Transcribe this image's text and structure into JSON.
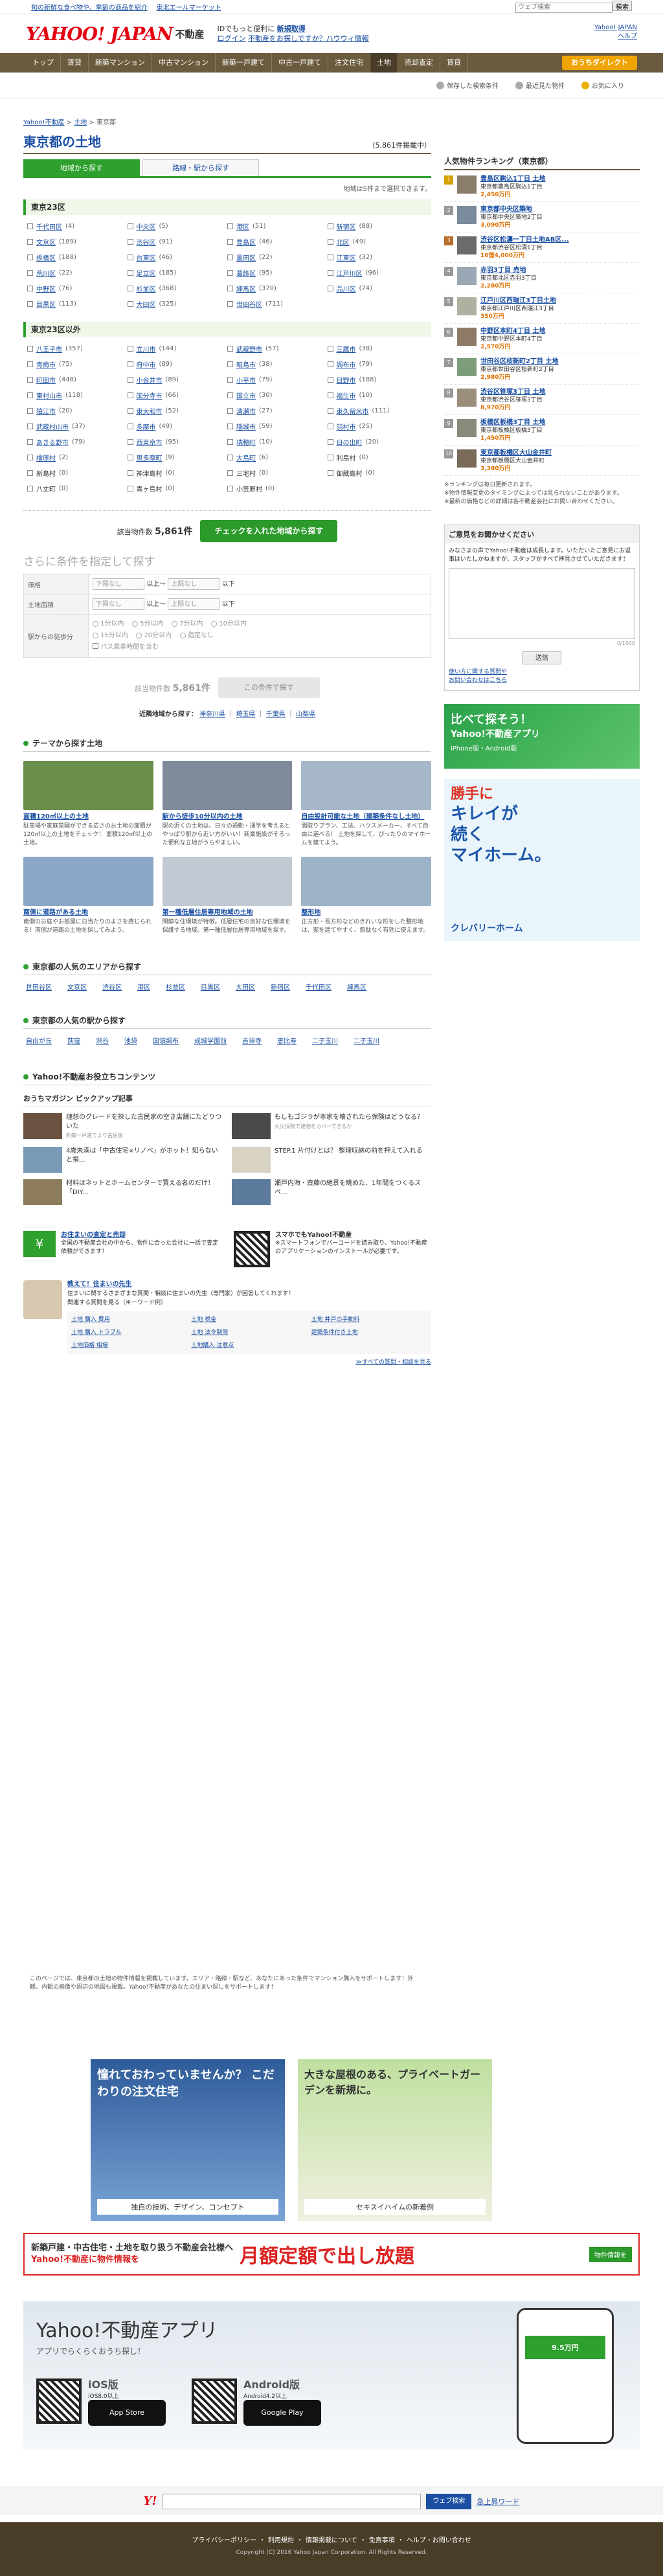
{
  "topbar": {
    "links": [
      "旬の新鮮な食べ物や、季節の商品を紹介",
      "東北エールマーケット"
    ],
    "search_placeholder": "ウェブ検索",
    "search_btn": "検索"
  },
  "header": {
    "logo_y": "YAHOO! JAPAN",
    "logo_fd": "不動産",
    "sub1": "IDでもっと便利に",
    "sub1b": "新規取得",
    "sub2": "ログイン",
    "sub3": "不動産をお探しですか？ハウウィ情報",
    "right1": "Yahoo! JAPAN",
    "right2": "ヘルプ"
  },
  "gnav": {
    "items": [
      "トップ",
      "賃貸",
      "新築マンション",
      "中古マンション",
      "新築一戸建て",
      "中古一戸建て",
      "注文住宅",
      "土地",
      "売却査定",
      "賃貸"
    ],
    "active": 7,
    "direct": "おうちダイレクト"
  },
  "subnav": {
    "items": [
      "保存した検索条件",
      "最近見た物件",
      "お気に入り"
    ]
  },
  "crumb": [
    "Yahoo!不動産",
    "土地",
    "東京都"
  ],
  "page": {
    "title": "東京都の土地",
    "count": "（5,861件掲載中）",
    "tab1": "地域から探す",
    "tab2": "路線・駅から探す",
    "note": "地域は5件まで選択できます。"
  },
  "sec1": {
    "title": "東京23区",
    "items": [
      [
        "千代田区",
        "(4)"
      ],
      [
        "中央区",
        "(5)"
      ],
      [
        "港区",
        "(51)"
      ],
      [
        "新宿区",
        "(88)"
      ],
      [
        "文京区",
        "(189)"
      ],
      [
        "渋谷区",
        "(91)"
      ],
      [
        "豊島区",
        "(46)"
      ],
      [
        "北区",
        "(49)"
      ],
      [
        "板橋区",
        "(188)"
      ],
      [
        "台東区",
        "(46)"
      ],
      [
        "墨田区",
        "(22)"
      ],
      [
        "江東区",
        "(32)"
      ],
      [
        "荒川区",
        "(22)"
      ],
      [
        "足立区",
        "(185)"
      ],
      [
        "葛飾区",
        "(95)"
      ],
      [
        "江戸川区",
        "(96)"
      ],
      [
        "中野区",
        "(76)"
      ],
      [
        "杉並区",
        "(368)"
      ],
      [
        "練馬区",
        "(370)"
      ],
      [
        "品川区",
        "(74)"
      ],
      [
        "目黒区",
        "(113)"
      ],
      [
        "大田区",
        "(325)"
      ],
      [
        "世田谷区",
        "(711)"
      ],
      [
        "",
        ""
      ]
    ]
  },
  "sec2": {
    "title": "東京23区以外",
    "items": [
      [
        "八王子市",
        "(357)"
      ],
      [
        "立川市",
        "(144)"
      ],
      [
        "武蔵野市",
        "(57)"
      ],
      [
        "三鷹市",
        "(38)"
      ],
      [
        "青梅市",
        "(75)"
      ],
      [
        "府中市",
        "(89)"
      ],
      [
        "昭島市",
        "(38)"
      ],
      [
        "調布市",
        "(79)"
      ],
      [
        "町田市",
        "(448)"
      ],
      [
        "小金井市",
        "(89)"
      ],
      [
        "小平市",
        "(79)"
      ],
      [
        "日野市",
        "(188)"
      ],
      [
        "東村山市",
        "(118)"
      ],
      [
        "国分寺市",
        "(66)"
      ],
      [
        "国立市",
        "(30)"
      ],
      [
        "福生市",
        "(10)"
      ],
      [
        "狛江市",
        "(20)"
      ],
      [
        "東大和市",
        "(52)"
      ],
      [
        "清瀬市",
        "(27)"
      ],
      [
        "東久留米市",
        "(111)"
      ],
      [
        "武蔵村山市",
        "(37)"
      ],
      [
        "多摩市",
        "(49)"
      ],
      [
        "稲城市",
        "(59)"
      ],
      [
        "羽村市",
        "(25)"
      ],
      [
        "あきる野市",
        "(79)"
      ],
      [
        "西東京市",
        "(95)"
      ],
      [
        "瑞穂町",
        "(10)"
      ],
      [
        "日の出町",
        "(20)"
      ],
      [
        "檜原村",
        "(2)"
      ],
      [
        "奥多摩町",
        "(9)"
      ],
      [
        "大島町",
        "(6)"
      ],
      [
        "利島村",
        "(0)"
      ],
      [
        "新島村",
        "(0)"
      ],
      [
        "神津島村",
        "(0)"
      ],
      [
        "三宅村",
        "(0)"
      ],
      [
        "御蔵島村",
        "(0)"
      ],
      [
        "八丈町",
        "(0)"
      ],
      [
        "青ヶ島村",
        "(0)"
      ],
      [
        "小笠原村",
        "(0)"
      ],
      [
        "",
        ""
      ]
    ]
  },
  "select": {
    "label": "該当物件数",
    "count": "5,861件",
    "btn": "チェックを入れた地域から探す"
  },
  "cond": {
    "title": "さらに条件を指定して探す",
    "r1": "価格",
    "r2": "土地面積",
    "r3": "駅からの徒歩分",
    "any": "下限なし",
    "up": "上限なし",
    "to": "以上〜",
    "pt": "以下",
    "walk": [
      "1分以内",
      "5分以内",
      "7分以内",
      "10分以内",
      "15分以内",
      "20分以内",
      "指定なし"
    ],
    "bus": "バス乗車時間を含む",
    "count_label": "該当物件数",
    "count": "5,861件",
    "btn": "この条件で探す"
  },
  "nearby": {
    "label": "近隣地域から探す：",
    "items": [
      "神奈川県",
      "埼玉県",
      "千葉県",
      "山梨県"
    ]
  },
  "themes": {
    "title": "テーマから探す土地",
    "items": [
      {
        "t": "面積120㎡以上の土地",
        "d": "駐車場や家庭菜園ができる広さのお土地の面積が120㎡以上の土地をチェック！ 面積120㎡以上の土地。",
        "c": "#6a8f4a"
      },
      {
        "t": "駅から徒歩10分以内の土地",
        "d": "駅の近くの土地は、日々の通勤・通学を考えるとやっぱり駅から近い方がいい！商業施設がそろった便利な立地がうらやましい。",
        "c": "#7f8a9a"
      },
      {
        "t": "自由設計可能な土地（建築条件なし土地）",
        "d": "間取りプラン、工法、ハウスメーカー、すべて自由に選べる！ 土地を探して、ぴったりのマイホームを建てよう。",
        "c": "#a6b7c9"
      },
      {
        "t": "南側に道路がある土地",
        "d": "南側のお庭やお部屋に日当たりのよさを感じられる！南側が道路の土地を探してみよう。",
        "c": "#8aa7c7"
      },
      {
        "t": "第一種低層住居専用地域の土地",
        "d": "閑静な住環境が特徴。低層住宅の良好な住環境を保護する地域。第一種低層住居専用地域を探す。",
        "c": "#c1c9d2"
      },
      {
        "t": "整形地",
        "d": "正方形・長方形などのきれいな形をした整形地は、家を建てやすく、無駄なく有効に使えます。",
        "c": "#9cb3c8"
      }
    ]
  },
  "areas": {
    "title": "東京都の人気のエリアから探す",
    "items": [
      "世田谷区",
      "文京区",
      "渋谷区",
      "港区",
      "杉並区",
      "目黒区",
      "大田区",
      "新宿区",
      "千代田区",
      "練馬区"
    ]
  },
  "stations": {
    "title": "東京都の人気の駅から探す",
    "items": [
      "自由が丘",
      "荻窪",
      "渋谷",
      "池袋",
      "国領調布",
      "成城学園前",
      "吉祥寺",
      "恵比寿",
      "二子玉川",
      "二子玉川"
    ]
  },
  "useful": {
    "title": "Yahoo!不動産お役立ちコンテンツ",
    "mag_title": "おうちマガジン  ピックアップ記事",
    "articles": [
      {
        "t": "理想のグレードを探した古民家の空き店舗にたどりついた",
        "s": "新築一戸建てより古民家",
        "c": "#6b5140"
      },
      {
        "t": "もしもゴジラが本家を壊されたら保険はどうなる？",
        "s": "火災保険で建物をカバーできるか",
        "c": "#4a4a4a"
      },
      {
        "t": "4歳未満は「中古住宅×リノベ」がホット！知らないと損...",
        "s": "",
        "c": "#7b9ab8"
      },
      {
        "t": "STEP.1 片付けとは？ 整理収納の前を押えて入れる",
        "s": "",
        "c": "#d9d3c4"
      },
      {
        "t": "材料はネットとホームセンターで買える名のだけ！「DIY...",
        "s": "",
        "c": "#8c7c5c"
      },
      {
        "t": "瀬戸内海・齋藤の絶景を眺めた、1年間をつくるスペ...",
        "s": "",
        "c": "#5c7a9c"
      }
    ],
    "box1_t": "お住まいの査定と売却",
    "box1_d": "全国の不動産会社の中から、物件に合った会社に一括で査定依頼ができます！",
    "box2_t": "スマホでもYahoo!不動産",
    "box2_d": "※スマートフォンでバーコードを読み取り、Yahoo!不動産のアプリケーションのインストールが必要です。",
    "box3_t": "教えて！住まいの先生",
    "box3_d": "住まいに関するさまざまな質問・相談に住まいの先生（専門家）が回答してくれます！",
    "box3_s": "関連する質問を見る（キーワード例）",
    "kw": [
      "土地 購入 費用",
      "土地 税金",
      "土地 井戸の手動料",
      "土地 購入 トラブル",
      "土地 法令制限",
      "建築条件付き土地",
      "土地価格 相場",
      "土地購入 注意点"
    ],
    "all": "≫すべての質問・相談を見る"
  },
  "ranking": {
    "title": "人気物件ランキング（東京都）",
    "items": [
      {
        "t": "豊島区駒込1丁目 土地",
        "a": "東京都豊島区駒込1丁目",
        "p": "2,450万円",
        "c": "#8b7d6b"
      },
      {
        "t": "東京都中央区築地",
        "a": "東京都中央区築地2丁目",
        "p": "3,090万円",
        "c": "#7a8c9b"
      },
      {
        "t": "渋谷区松濤一丁目土地AB区...",
        "a": "東京都渋谷区松濤1丁目",
        "p": "16億4,000万円",
        "c": "#6b6b6b"
      },
      {
        "t": "赤羽3丁目 売地",
        "a": "東京都北区赤羽3丁目",
        "p": "2,280万円",
        "c": "#9aa8b5"
      },
      {
        "t": "江戸川区西瑞江3丁目土地",
        "a": "東京都江戸川区西瑞江3丁目",
        "p": "350万円",
        "c": "#b0b0a0"
      },
      {
        "t": "中野区本町4丁目 土地",
        "a": "東京都中野区本町4丁目",
        "p": "2,570万円",
        "c": "#8d7a66"
      },
      {
        "t": "世田谷区桜新町2丁目 土地",
        "a": "東京都世田谷区桜新町2丁目",
        "p": "2,980万円",
        "c": "#7c9c7a"
      },
      {
        "t": "渋谷区笹塚3丁目 土地",
        "a": "東京都渋谷区笹塚3丁目",
        "p": "8,970万円",
        "c": "#9b8e7a"
      },
      {
        "t": "板橋区板橋3丁目 土地",
        "a": "東京都板橋区板橋3丁目",
        "p": "1,450万円",
        "c": "#8a8a7a"
      },
      {
        "t": "東京都板橋区大山金井町",
        "a": "東京都板橋区大山金井町",
        "p": "3,380万円",
        "c": "#7a6a5a"
      }
    ],
    "note": "※ランキングは毎日更新されます。\n※物件情報変更のタイミングによっては見られないことがあります。\n※最新の価格などの詳細は各不動産会社にお問い合わせください。"
  },
  "opinion": {
    "title": "ご意見をお聞かせください",
    "desc": "みなさまの声でYahoo!不動産は成長します。いただいたご意見にお返事はいたしかねますが、スタッフがすべて拝見させていただきます！",
    "count": "0/1000",
    "btn": "送信",
    "l1": "使い方に関する質問や",
    "l2": "お問い合わせはこちら"
  },
  "ads": {
    "a1_sm": "比べて探そう！",
    "a1_big": "Yahoo!不動産アプリ",
    "a1_os": "iPhone版・Android版",
    "a2_1": "勝手に",
    "a2_2": "キレイが",
    "a2_3": "続く",
    "a2_4": "マイホーム。",
    "a2_brand": "クレバリーホーム",
    "a3_hd": "憧れておわっていませんか？ こだわりの注文住宅",
    "a3_bt": "独自の技術、デザイン、コンセプト",
    "a4_hd": "大きな屋根のある、プライベートガーデンを新規に。",
    "a4_bt": "セキスイハイムの新着例"
  },
  "footnote": "このページでは、東京都の土地の物件情報を掲載しています。エリア・路線・駅など、あなたにあった条件でマンション購入をサポートします！外観、内観の画像や周辺の地図も掲載。Yahoo!不動産があなたの住まい探しをサポートします！",
  "banner": {
    "l1": "新築戸建・中古住宅・土地を取り扱う不動産会社様へ",
    "l2": "Yahoo!不動産に物件情報を",
    "big": "月額定額で出し放題",
    "tag": "物件情報を"
  },
  "app": {
    "title": "Yahoo!不動産アプリ",
    "sub": "アプリでらくらくおうち探し！",
    "ios": "iOS版",
    "ios_v": "iOS8.0以上",
    "android": "Android版",
    "android_v": "Android4.2以上",
    "as": "App Store",
    "gp": "Google Play",
    "price": "9.5万円"
  },
  "bsearch": {
    "btn": "ウェブ検索",
    "link": "急上昇ワード"
  },
  "footer": {
    "links": [
      "プライバシーポリシー",
      "利用規約",
      "情報掲載について",
      "免責事項",
      "ヘルプ・お問い合わせ"
    ],
    "copy": "Copyright (C) 2016 Yahoo Japan Corporation. All Rights Reserved."
  }
}
